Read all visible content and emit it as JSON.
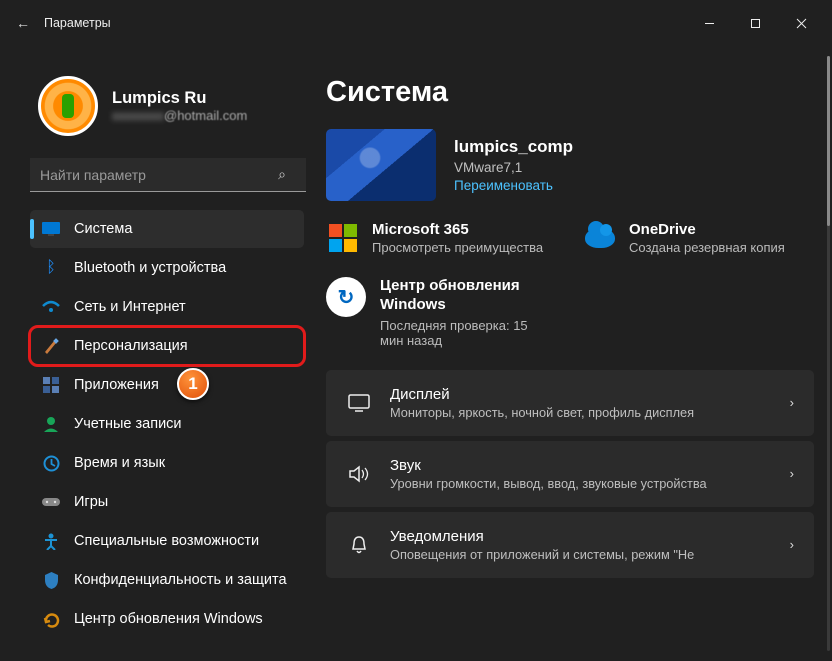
{
  "titlebar": {
    "title": "Параметры"
  },
  "profile": {
    "name": "Lumpics Ru",
    "email": "@hotmail.com"
  },
  "search": {
    "placeholder": "Найти параметр"
  },
  "sidebar": {
    "items": [
      {
        "label": "Система"
      },
      {
        "label": "Bluetooth и устройства"
      },
      {
        "label": "Сеть и Интернет"
      },
      {
        "label": "Персонализация"
      },
      {
        "label": "Приложения"
      },
      {
        "label": "Учетные записи"
      },
      {
        "label": "Время и язык"
      },
      {
        "label": "Игры"
      },
      {
        "label": "Специальные возможности"
      },
      {
        "label": "Конфиденциальность и защита"
      },
      {
        "label": "Центр обновления Windows"
      }
    ]
  },
  "badge": {
    "num": "1"
  },
  "main": {
    "heading": "Система",
    "hero": {
      "pc_name": "lumpics_comp",
      "model": "VMware7,1",
      "rename": "Переименовать"
    },
    "promos": [
      {
        "title": "Microsoft 365",
        "sub": "Просмотреть преимущества"
      },
      {
        "title": "OneDrive",
        "sub": "Создана резервная копия"
      }
    ],
    "update": {
      "title": "Центр обновления Windows",
      "sub": "Последняя проверка: 15 мин назад"
    },
    "settings": [
      {
        "title": "Дисплей",
        "sub": "Мониторы, яркость, ночной свет, профиль дисплея"
      },
      {
        "title": "Звук",
        "sub": "Уровни громкости, вывод, ввод, звуковые устройства"
      },
      {
        "title": "Уведомления",
        "sub": "Оповещения от приложений и системы, режим \"Не"
      }
    ]
  }
}
